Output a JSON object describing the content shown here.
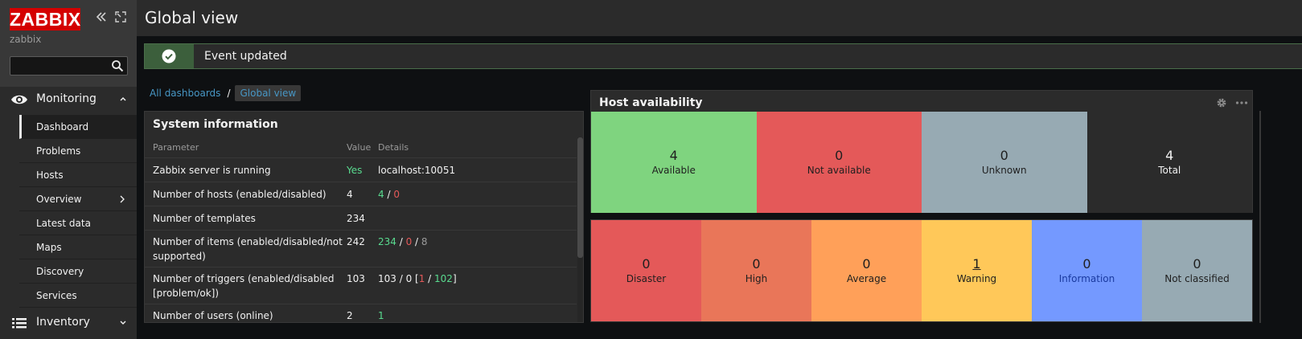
{
  "sidebar": {
    "logo": "ZABBIX",
    "server_name": "zabbix",
    "search_value": "",
    "monitoring_label": "Monitoring",
    "inventory_label": "Inventory",
    "items": [
      {
        "label": "Dashboard",
        "active": true
      },
      {
        "label": "Problems"
      },
      {
        "label": "Hosts"
      },
      {
        "label": "Overview",
        "has_submenu": true
      },
      {
        "label": "Latest data"
      },
      {
        "label": "Maps"
      },
      {
        "label": "Discovery"
      },
      {
        "label": "Services"
      }
    ]
  },
  "header": {
    "title": "Global view"
  },
  "message": {
    "text": "Event updated"
  },
  "breadcrumb": {
    "all": "All dashboards",
    "separator": "/",
    "current": "Global view"
  },
  "system_info": {
    "title": "System information",
    "columns": [
      "Parameter",
      "Value",
      "Details"
    ],
    "rows": [
      {
        "param": "Zabbix server is running",
        "value": "Yes",
        "details": "localhost:10051"
      },
      {
        "param": "Number of hosts (enabled/disabled)",
        "value": "4",
        "d1": "4",
        "dsep": " / ",
        "d2": "0"
      },
      {
        "param": "Number of templates",
        "value": "234"
      },
      {
        "param_line1": "Number of items (enabled/disabled/not",
        "param_line2": "supported)",
        "value": "242",
        "d1": "234",
        "dsep1": " / ",
        "d2": "0",
        "dsep2": " / ",
        "d3": "8"
      },
      {
        "param_line1": "Number of triggers (enabled/disabled",
        "param_line2": "[problem/ok])",
        "value": "103",
        "dpre": "103 / 0 [",
        "d1": "1",
        "dsep": " / ",
        "d2": "102",
        "dpost": "]"
      },
      {
        "param": "Number of users (online)",
        "value": "2",
        "d1": "1"
      }
    ]
  },
  "host_availability": {
    "title": "Host availability",
    "cells": [
      {
        "count": "4",
        "label": "Available",
        "color": "#7fd47f"
      },
      {
        "count": "0",
        "label": "Not available",
        "color": "#e45959"
      },
      {
        "count": "0",
        "label": "Unknown",
        "color": "#97aab3"
      },
      {
        "count": "4",
        "label": "Total",
        "color": "#2b2b2b"
      }
    ]
  },
  "problems_by_severity": {
    "cells": [
      {
        "count": "0",
        "label": "Disaster",
        "color": "#e45959"
      },
      {
        "count": "0",
        "label": "High",
        "color": "#e97659"
      },
      {
        "count": "0",
        "label": "Average",
        "color": "#ffa059"
      },
      {
        "count": "1",
        "label": "Warning",
        "color": "#ffc859"
      },
      {
        "count": "0",
        "label": "Information",
        "color": "#7499ff"
      },
      {
        "count": "0",
        "label": "Not classified",
        "color": "#97aab3"
      }
    ]
  }
}
